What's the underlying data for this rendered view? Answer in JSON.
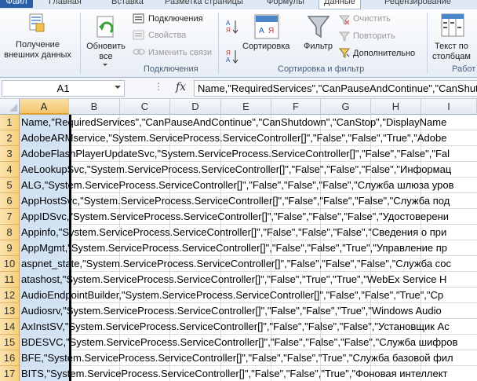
{
  "ribbon_tabs": {
    "file": "Файл",
    "home": "Главная",
    "insert": "Вставка",
    "page_layout": "Разметка страницы",
    "formulas": "Формулы",
    "data": "Данные",
    "review": "Рецензирование"
  },
  "ribbon": {
    "get_external_data_line1": "Получение",
    "get_external_data_line2": "внешних данных",
    "refresh_all_line1": "Обновить",
    "refresh_all_line2": "все",
    "connections": "Подключения",
    "properties": "Свойства",
    "edit_links": "Изменить связи",
    "group_connections": "Подключения",
    "sort": "Сортировка",
    "filter": "Фильтр",
    "clear": "Очистить",
    "reapply": "Повторить",
    "advanced": "Дополнительно",
    "group_sort_filter": "Сортировка и фильтр",
    "text_to_columns_line1": "Текст по",
    "text_to_columns_line2": "столбцам",
    "group_data_tools": "Работ"
  },
  "formula_bar": {
    "name_box": "A1",
    "fx": "fx",
    "formula": "Name,\"RequiredServices\",\"CanPauseAndContinue\",\"CanShutdown\",\"CanStop\",\"DisplayName"
  },
  "columns": [
    "A",
    "B",
    "C",
    "D",
    "E",
    "F",
    "G",
    "H",
    "I"
  ],
  "rows": [
    {
      "num": "1",
      "text": "Name,\"RequiredServices\",\"CanPauseAndContinue\",\"CanShutdown\",\"CanStop\",\"DisplayName"
    },
    {
      "num": "2",
      "text": "AdobeARMservice,\"System.ServiceProcess.ServiceController[]\",\"False\",\"False\",\"True\",\"Adobe"
    },
    {
      "num": "3",
      "text": "AdobeFlashPlayerUpdateSvc,\"System.ServiceProcess.ServiceController[]\",\"False\",\"False\",\"Fal"
    },
    {
      "num": "4",
      "text": "AeLookupSvc,\"System.ServiceProcess.ServiceController[]\",\"False\",\"False\",\"False\",\"Информац"
    },
    {
      "num": "5",
      "text": "ALG,\"System.ServiceProcess.ServiceController[]\",\"False\",\"False\",\"False\",\"Служба шлюза уров"
    },
    {
      "num": "6",
      "text": "AppHostSvc,\"System.ServiceProcess.ServiceController[]\",\"False\",\"False\",\"False\",\"Служба под"
    },
    {
      "num": "7",
      "text": "AppIDSvc,\"System.ServiceProcess.ServiceController[]\",\"False\",\"False\",\"False\",\"Удостоверени"
    },
    {
      "num": "8",
      "text": "Appinfo,\"System.ServiceProcess.ServiceController[]\",\"False\",\"False\",\"False\",\"Сведения о при"
    },
    {
      "num": "9",
      "text": "AppMgmt,\"System.ServiceProcess.ServiceController[]\",\"False\",\"False\",\"True\",\"Управление пр"
    },
    {
      "num": "10",
      "text": "aspnet_state,\"System.ServiceProcess.ServiceController[]\",\"False\",\"False\",\"False\",\"Служба сос"
    },
    {
      "num": "11",
      "text": "atashost,\"System.ServiceProcess.ServiceController[]\",\"False\",\"True\",\"True\",\"WebEx Service H"
    },
    {
      "num": "12",
      "text": "AudioEndpointBuilder,\"System.ServiceProcess.ServiceController[]\",\"False\",\"False\",\"True\",\"Ср"
    },
    {
      "num": "13",
      "text": "Audiosrv,\"System.ServiceProcess.ServiceController[]\",\"False\",\"False\",\"True\",\"Windows Audio"
    },
    {
      "num": "14",
      "text": "AxInstSV,\"System.ServiceProcess.ServiceController[]\",\"False\",\"False\",\"False\",\"Установщик Ac"
    },
    {
      "num": "15",
      "text": "BDESVC,\"System.ServiceProcess.ServiceController[]\",\"False\",\"False\",\"False\",\"Служба шифров"
    },
    {
      "num": "16",
      "text": "BFE,\"System.ServiceProcess.ServiceController[]\",\"False\",\"False\",\"True\",\"Служба базовой фил"
    },
    {
      "num": "17",
      "text": "BITS,\"System.ServiceProcess.ServiceController[]\",\"False\",\"False\",\"True\",\"Фоновая интеллект"
    }
  ],
  "colors": {
    "selection_fill": "#d2e3f6",
    "header_selected": "#f3c46b",
    "file_tab": "#2a5fa8"
  }
}
